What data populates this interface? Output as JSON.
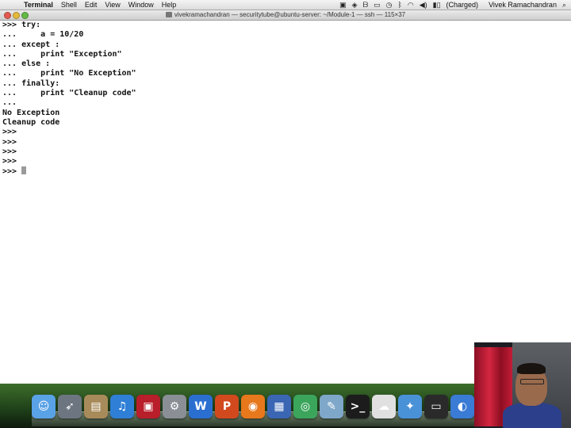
{
  "menubar": {
    "apple_glyph": "",
    "app_name": "Terminal",
    "menus": [
      "Shell",
      "Edit",
      "View",
      "Window",
      "Help"
    ],
    "status_icons": [
      "bookmark-icon",
      "dropbox-icon",
      "b-icon",
      "display-icon",
      "time-machine-icon",
      "bluetooth-icon",
      "wifi-icon",
      "volume-icon",
      "battery-icon"
    ],
    "battery_text": "(Charged)",
    "user_name": "Vivek Ramachandran",
    "spotlight_glyph": "⌕"
  },
  "window": {
    "title": "vivekramachandran — securitytube@ubuntu-server: ~/Module-1 — ssh — 115×37"
  },
  "terminal": {
    "lines": [
      ">>> try:",
      "...     a = 10/20",
      "... except :",
      "...     print \"Exception\"",
      "... else :",
      "...     print \"No Exception\"",
      "... finally:",
      "...     print \"Cleanup code\"",
      "...",
      "No Exception",
      "Cleanup code",
      ">>>",
      ">>>",
      ">>>",
      ">>>"
    ],
    "prompt": ">>> "
  },
  "dock": {
    "items": [
      {
        "name": "finder-icon",
        "color": "#5aa2e6",
        "glyph": "☺"
      },
      {
        "name": "launchpad-icon",
        "color": "#6d7680",
        "glyph": "➶"
      },
      {
        "name": "preview-icon",
        "color": "#a88b5a",
        "glyph": "▤"
      },
      {
        "name": "itunes-icon",
        "color": "#2f7fd6",
        "glyph": "♫"
      },
      {
        "name": "photo-booth-icon",
        "color": "#b81f2a",
        "glyph": "▣"
      },
      {
        "name": "system-preferences-icon",
        "color": "#8a8f96",
        "glyph": "⚙"
      },
      {
        "name": "word-icon",
        "color": "#2a6fd0",
        "glyph": "W"
      },
      {
        "name": "powerpoint-icon",
        "color": "#d2491e",
        "glyph": "P"
      },
      {
        "name": "firefox-icon",
        "color": "#e8781c",
        "glyph": "◉"
      },
      {
        "name": "virtualbox-icon",
        "color": "#3a66b4",
        "glyph": "▦"
      },
      {
        "name": "chrome-icon",
        "color": "#3ba55c",
        "glyph": "◎"
      },
      {
        "name": "xcode-icon",
        "color": "#7fa7c9",
        "glyph": "✎"
      },
      {
        "name": "terminal-icon",
        "color": "#1c1c1c",
        "glyph": ">_"
      },
      {
        "name": "sheep-icon",
        "color": "#e0e0e0",
        "glyph": "☁"
      },
      {
        "name": "safari-icon",
        "color": "#4a92d8",
        "glyph": "✦"
      },
      {
        "name": "display-app-icon",
        "color": "#2a2a2a",
        "glyph": "▭"
      },
      {
        "name": "misc-app-icon",
        "color": "#3a7bd5",
        "glyph": "◐"
      }
    ]
  }
}
